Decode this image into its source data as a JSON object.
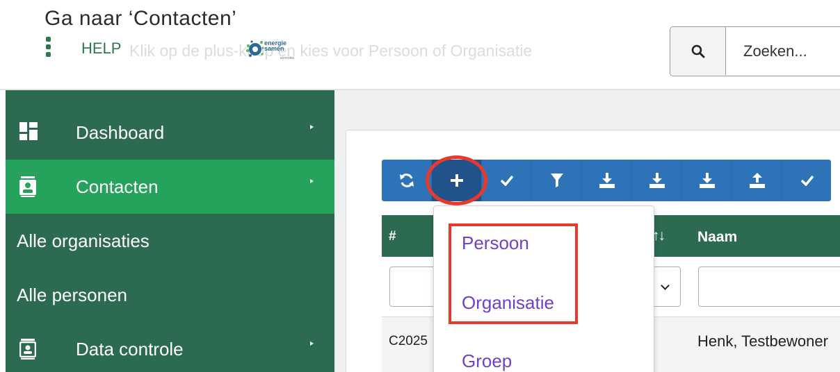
{
  "background_text": {
    "line1": "Ga naar ‘Contacten’",
    "line2": "Klik op de plus-knop en kies voor Persoon of Organisatie"
  },
  "topbar": {
    "help_label": "HELP",
    "logo": {
      "line1": "energie",
      "line2": "samen",
      "sub": "econobis"
    },
    "search_placeholder": "Zoeken..."
  },
  "sidebar": {
    "items": [
      {
        "label": "Dashboard",
        "icon": "dashboard-icon"
      },
      {
        "label": "Contacten",
        "icon": "contact-card-icon",
        "active": true
      },
      {
        "label": "Data controle",
        "icon": "data-control-icon"
      }
    ],
    "submenu": [
      {
        "label": "Alle organisaties"
      },
      {
        "label": "Alle personen"
      }
    ]
  },
  "toolbar": {
    "buttons": [
      {
        "icon": "refresh-icon"
      },
      {
        "icon": "plus-icon",
        "highlighted": true
      },
      {
        "icon": "check-icon"
      },
      {
        "icon": "filter-icon"
      },
      {
        "icon": "download-icon"
      },
      {
        "icon": "download-icon"
      },
      {
        "icon": "download-icon"
      },
      {
        "icon": "upload-icon"
      },
      {
        "icon": "check-icon"
      }
    ]
  },
  "table": {
    "headers": {
      "hash": "#",
      "sort_arrows": "↑↓",
      "naam": "Naam"
    },
    "rows": [
      {
        "id": "C2025",
        "naam": "Henk, Testbewoner"
      }
    ]
  },
  "dropdown": {
    "items": [
      "Persoon",
      "Organisatie",
      "Groep"
    ]
  },
  "colors": {
    "sidebar_bg": "#2d6b50",
    "sidebar_active": "#25a35d",
    "toolbar_bg": "#2e73b8",
    "link_purple": "#7140c8",
    "highlight_red": "#e83a2c"
  }
}
